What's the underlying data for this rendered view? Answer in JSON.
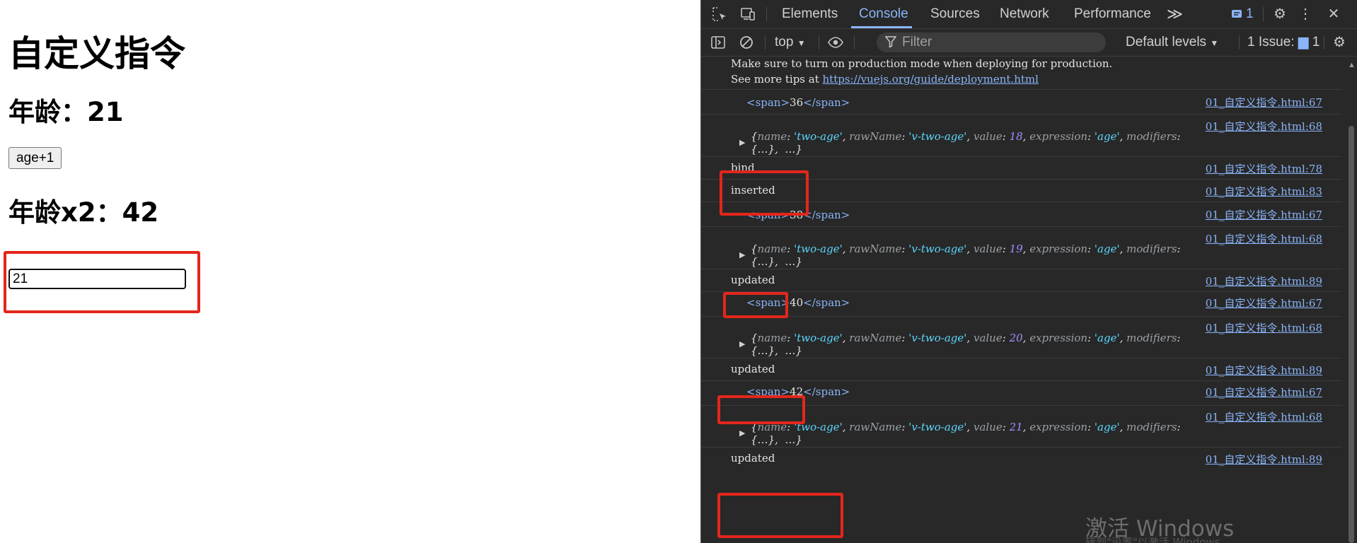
{
  "page": {
    "title": "自定义指令",
    "age_label": "年龄：21",
    "button_label": "age+1",
    "age2_label": "年龄x2：42",
    "input_value": "21"
  },
  "devtools": {
    "tabs": [
      "Elements",
      "Console",
      "Sources",
      "Network",
      "Performance"
    ],
    "more_tabs": "≫",
    "issues_count_badge": "1",
    "context": "top",
    "filter_placeholder": "Filter",
    "levels": "Default levels",
    "issues_label": "1 Issue:",
    "issues_count": "1"
  },
  "console": {
    "intro_line1": "Make sure to turn on production mode when deploying for production.",
    "intro_line2_prefix": "See more tips at ",
    "intro_link": "https://vuejs.org/guide/deployment.html",
    "src67": "01_自定义指令.html:67",
    "src68": "01_自定义指令.html:68",
    "src78": "01_自定义指令.html:78",
    "src83": "01_自定义指令.html:83",
    "src89": "01_自定义指令.html:89",
    "span_open": "<span>",
    "span_close": "</span>",
    "span_values": [
      "36",
      "38",
      "40",
      "42"
    ],
    "binding_values": [
      "18",
      "19",
      "20",
      "21"
    ],
    "binding_name": "'two-age'",
    "binding_rawname": "'v-two-age'",
    "binding_expression": "'age'",
    "bind": "bind",
    "inserted": "inserted",
    "updated": "updated"
  },
  "watermark": "激活 Windows",
  "watermark_sub": "转到\"设置\"以激活 Windows。",
  "colors": {
    "highlight": "#e3261c",
    "devtools_bg": "#282828",
    "link": "#8ab4f8",
    "accent": "#8ab4f8"
  }
}
